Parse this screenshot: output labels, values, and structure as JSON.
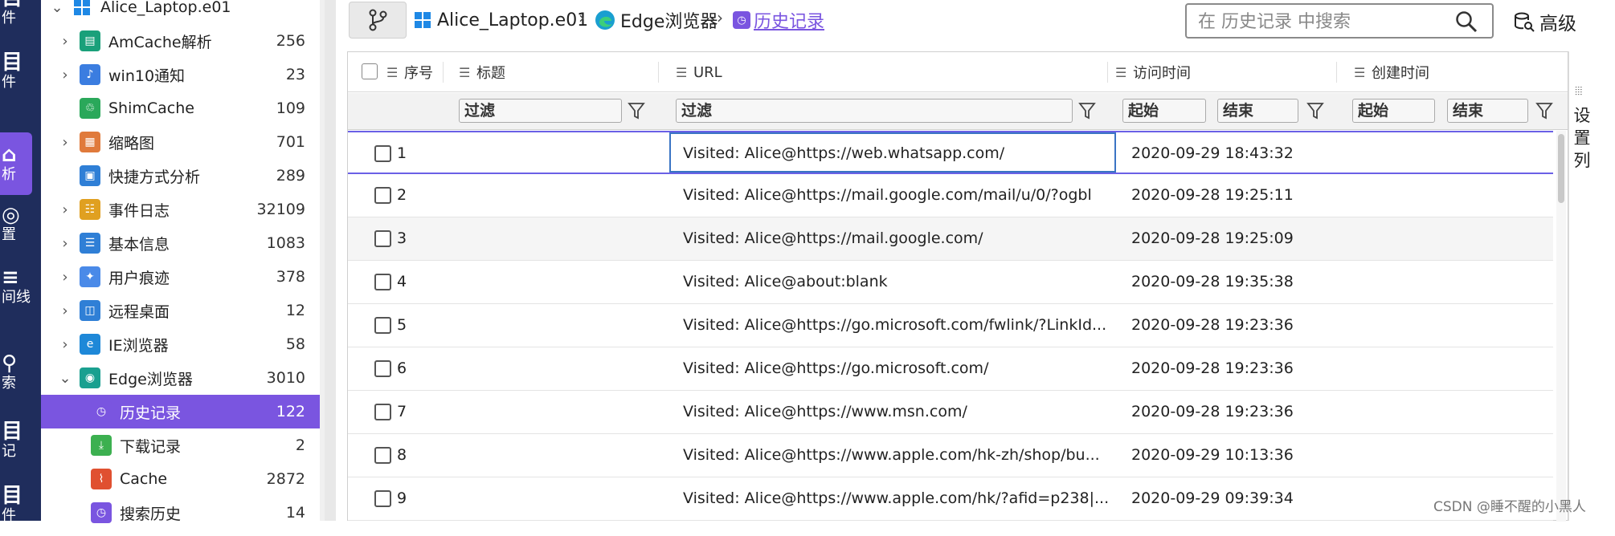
{
  "rail": {
    "items": [
      {
        "icon": "file-icon",
        "glyph": "目",
        "label": "件",
        "active": false
      },
      {
        "icon": "file-icon",
        "glyph": "目",
        "label": "件",
        "active": false
      },
      {
        "icon": "analysis-icon",
        "glyph": "⌂",
        "label": "析",
        "active": true
      },
      {
        "icon": "location-icon",
        "glyph": "◎",
        "label": "置",
        "active": false
      },
      {
        "icon": "timeline-icon",
        "glyph": "≡",
        "label": "间线",
        "active": false
      },
      {
        "icon": "search-icon",
        "glyph": "⚲",
        "label": "索",
        "active": false
      },
      {
        "icon": "record-icon",
        "glyph": "目",
        "label": "记",
        "active": false
      },
      {
        "icon": "file-icon",
        "glyph": "目",
        "label": "件",
        "active": false
      }
    ]
  },
  "tree": {
    "root_label": "Alice_Laptop.e01",
    "nodes": [
      {
        "label": "AmCache解析",
        "count": "256",
        "icon": "amcache-icon",
        "color": "#1aa07a",
        "level": 1,
        "expand": "collapsed"
      },
      {
        "label": "win10通知",
        "count": "23",
        "icon": "notification-bell-icon",
        "color": "#3b7de0",
        "level": 1,
        "expand": "collapsed"
      },
      {
        "label": "ShimCache",
        "count": "109",
        "icon": "shimcache-icon",
        "color": "#2aa85a",
        "level": 1,
        "expand": "none"
      },
      {
        "label": "缩略图",
        "count": "701",
        "icon": "thumbnail-grid-icon",
        "color": "#e07a3b",
        "level": 1,
        "expand": "collapsed"
      },
      {
        "label": "快捷方式分析",
        "count": "289",
        "icon": "shortcut-folder-icon",
        "color": "#2f7fd6",
        "level": 1,
        "expand": "none"
      },
      {
        "label": "事件日志",
        "count": "32109",
        "icon": "event-log-icon",
        "color": "#e0a020",
        "level": 1,
        "expand": "collapsed"
      },
      {
        "label": "基本信息",
        "count": "1083",
        "icon": "basic-info-icon",
        "color": "#2f7fd6",
        "level": 1,
        "expand": "collapsed"
      },
      {
        "label": "用户痕迹",
        "count": "378",
        "icon": "user-trace-icon",
        "color": "#4a8ae8",
        "level": 1,
        "expand": "collapsed"
      },
      {
        "label": "远程桌面",
        "count": "12",
        "icon": "remote-desktop-icon",
        "color": "#2f7fd6",
        "level": 1,
        "expand": "collapsed"
      },
      {
        "label": "IE浏览器",
        "count": "58",
        "icon": "ie-browser-icon",
        "color": "#1e88d8",
        "level": 1,
        "expand": "collapsed"
      },
      {
        "label": "Edge浏览器",
        "count": "3010",
        "icon": "edge-browser-icon",
        "color": "#1aa090",
        "level": 1,
        "expand": "expanded"
      },
      {
        "label": "历史记录",
        "count": "122",
        "icon": "history-icon",
        "color": "#7a55e0",
        "level": 2,
        "expand": "none",
        "selected": true
      },
      {
        "label": "下载记录",
        "count": "2",
        "icon": "download-icon",
        "color": "#3cb050",
        "level": 2,
        "expand": "none"
      },
      {
        "label": "Cache",
        "count": "2872",
        "icon": "cache-broom-icon",
        "color": "#e05030",
        "level": 2,
        "expand": "none"
      },
      {
        "label": "搜索历史",
        "count": "14",
        "icon": "search-history-icon",
        "color": "#7a55e0",
        "level": 2,
        "expand": "none"
      }
    ]
  },
  "breadcrumb": {
    "items": [
      "Alice_Laptop.e01",
      "Edge浏览器",
      "历史记录"
    ]
  },
  "search": {
    "placeholder": "在 历史记录 中搜索"
  },
  "advanced_label": "高级",
  "grid": {
    "columns": [
      "序号",
      "标题",
      "URL",
      "访问时间",
      "创建时间"
    ],
    "filters": {
      "title": "过滤",
      "url": "过滤",
      "visit_start": "起始",
      "visit_end": "结束",
      "create_start": "起始",
      "create_end": "结束"
    },
    "settings_label": "设置列",
    "rows": [
      {
        "n": "1",
        "title": "",
        "url": "Visited: Alice@https://web.whatsapp.com/",
        "visit": "2020-09-29 18:43:32",
        "created": ""
      },
      {
        "n": "2",
        "title": "",
        "url": "Visited: Alice@https://mail.google.com/mail/u/0/?ogbl",
        "visit": "2020-09-28 19:25:11",
        "created": ""
      },
      {
        "n": "3",
        "title": "",
        "url": "Visited: Alice@https://mail.google.com/",
        "visit": "2020-09-28 19:25:09",
        "created": ""
      },
      {
        "n": "4",
        "title": "",
        "url": "Visited: Alice@about:blank",
        "visit": "2020-09-28 19:35:38",
        "created": ""
      },
      {
        "n": "5",
        "title": "",
        "url": "Visited: Alice@https://go.microsoft.com/fwlink/?LinkId...",
        "visit": "2020-09-28 19:23:36",
        "created": ""
      },
      {
        "n": "6",
        "title": "",
        "url": "Visited: Alice@https://go.microsoft.com/",
        "visit": "2020-09-28 19:23:36",
        "created": ""
      },
      {
        "n": "7",
        "title": "",
        "url": "Visited: Alice@https://www.msn.com/",
        "visit": "2020-09-28 19:23:36",
        "created": ""
      },
      {
        "n": "8",
        "title": "",
        "url": "Visited: Alice@https://www.apple.com/hk-zh/shop/bu...",
        "visit": "2020-09-29 10:13:36",
        "created": ""
      },
      {
        "n": "9",
        "title": "",
        "url": "Visited: Alice@https://www.apple.com/hk/?afid=p238|...",
        "visit": "2020-09-29 09:39:34",
        "created": ""
      }
    ]
  },
  "watermark": "CSDN @睡不醒的小黑人"
}
